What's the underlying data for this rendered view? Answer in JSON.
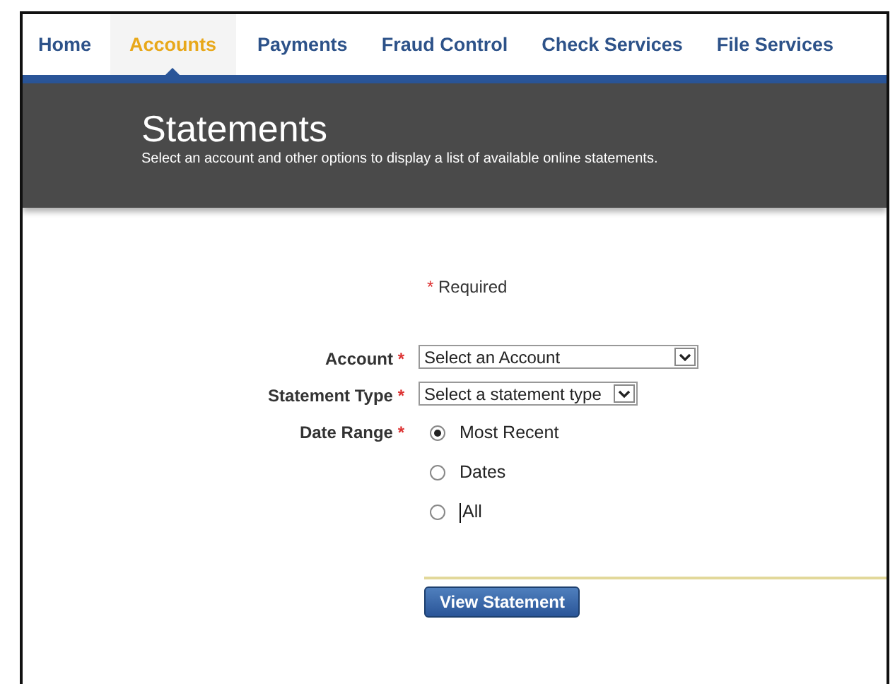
{
  "nav": [
    {
      "label": "Home",
      "selected": false
    },
    {
      "label": "Accounts",
      "selected": true
    },
    {
      "label": "Payments",
      "selected": false
    },
    {
      "label": "Fraud Control",
      "selected": false
    },
    {
      "label": "Check Services",
      "selected": false
    },
    {
      "label": "File Services",
      "selected": false
    }
  ],
  "header": {
    "title": "Statements",
    "subtitle": "Select an account and other options to display a list of available online statements."
  },
  "required_note": {
    "mark": "*",
    "text": "Required"
  },
  "fields": [
    {
      "kind": "select",
      "label": "Account",
      "mark": "*",
      "value": "Select an Account",
      "wide": true
    },
    {
      "kind": "select",
      "label": "Statement Type",
      "mark": "*",
      "value": "Select a statement type",
      "wide": false
    },
    {
      "kind": "radios",
      "label": "Date Range",
      "mark": "*",
      "options": [
        {
          "label": "Most Recent",
          "selected": true,
          "caret": false
        },
        {
          "label": "Dates",
          "selected": false,
          "caret": false
        },
        {
          "label": "All",
          "selected": false,
          "caret": true
        }
      ]
    }
  ],
  "submit": "View Statement"
}
